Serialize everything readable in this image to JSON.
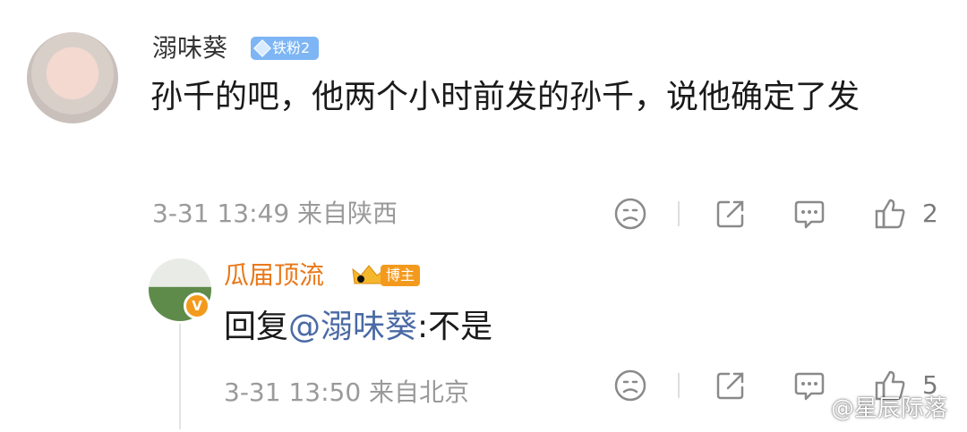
{
  "comment": {
    "username": "溺味葵",
    "fan_badge": "铁粉2",
    "text": "孙千的吧，他两个小时前发的孙千，说他确定了发",
    "meta": "3-31 13:49  来自陕西",
    "like_count": "2",
    "icons": [
      "sad-face-icon",
      "share-icon",
      "comment-icon",
      "like-icon"
    ]
  },
  "reply": {
    "username": "瓜届顶流",
    "badge_label": "博主",
    "verified_mark": "V",
    "reply_prefix": "回复",
    "mention": "@溺味葵",
    "reply_body": ":不是",
    "meta": "3-31 13:50  来自北京",
    "like_count": "5"
  },
  "watermark": "@星辰际落",
  "colors": {
    "accent_orange": "#e8781a",
    "mention_blue": "#4a6aa5",
    "fan_badge_blue": "#7eb5f4",
    "meta_gray": "#9a9a9a"
  }
}
